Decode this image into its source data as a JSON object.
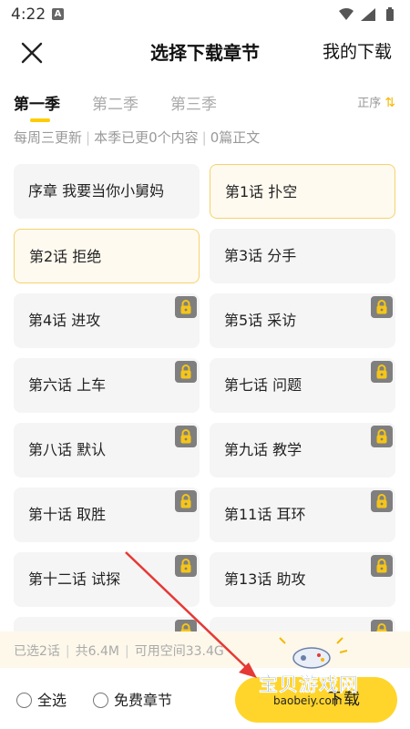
{
  "status": {
    "time": "4:22",
    "app_badge": "A"
  },
  "header": {
    "title": "选择下载章节",
    "my_downloads": "我的下载"
  },
  "tabs": [
    {
      "label": "第一季",
      "active": true
    },
    {
      "label": "第二季",
      "active": false
    },
    {
      "label": "第三季",
      "active": false
    }
  ],
  "order": {
    "label": "正序",
    "icon": "sort-arrows-icon"
  },
  "info": {
    "schedule": "每周三更新",
    "updated": "本季已更0个内容",
    "episodes": "0篇正文"
  },
  "chapters": [
    {
      "label": "序章 我要当你小舅妈",
      "selected": false,
      "locked": false
    },
    {
      "label": "第1话 扑空",
      "selected": true,
      "locked": false
    },
    {
      "label": "第2话 拒绝",
      "selected": true,
      "locked": false
    },
    {
      "label": "第3话 分手",
      "selected": false,
      "locked": false
    },
    {
      "label": "第4话 进攻",
      "selected": false,
      "locked": true
    },
    {
      "label": "第5话 采访",
      "selected": false,
      "locked": true
    },
    {
      "label": "第六话 上车",
      "selected": false,
      "locked": true
    },
    {
      "label": "第七话 问题",
      "selected": false,
      "locked": true
    },
    {
      "label": "第八话 默认",
      "selected": false,
      "locked": true
    },
    {
      "label": "第九话 教学",
      "selected": false,
      "locked": true
    },
    {
      "label": "第十话 取胜",
      "selected": false,
      "locked": true
    },
    {
      "label": "第11话 耳环",
      "selected": false,
      "locked": true
    },
    {
      "label": "第十二话 试探",
      "selected": false,
      "locked": true
    },
    {
      "label": "第13话 助攻",
      "selected": false,
      "locked": true
    },
    {
      "label": "",
      "selected": false,
      "locked": true
    },
    {
      "label": "",
      "selected": false,
      "locked": true
    }
  ],
  "summary": {
    "selected": "已选2话",
    "size": "共6.4M",
    "space": "可用空间33.4G"
  },
  "bottom": {
    "select_all": "全选",
    "free_chapters": "免费章节",
    "download": "下载"
  },
  "watermark": {
    "text": "宝贝游戏网",
    "url": "baobeiy.com"
  },
  "colors": {
    "accent": "#ffd52b",
    "selected_border": "#f3d36b",
    "lock": "#7f7f7f",
    "arrow": "#e53935"
  }
}
